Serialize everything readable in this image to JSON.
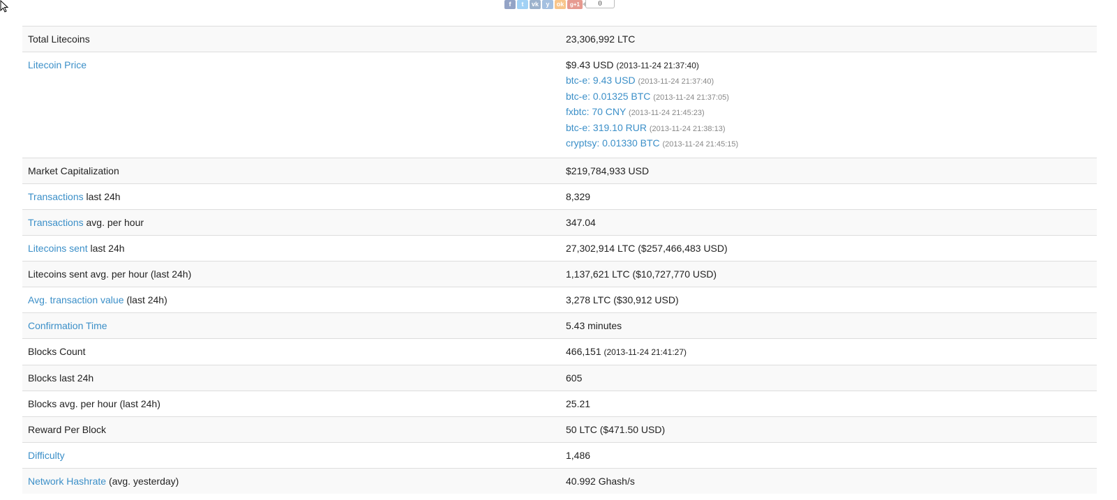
{
  "share": {
    "buttons": [
      {
        "id": "facebook",
        "glyph": "f",
        "color": "#3b5998"
      },
      {
        "id": "twitter",
        "glyph": "t",
        "color": "#55acee"
      },
      {
        "id": "vk",
        "glyph": "vk",
        "color": "#4c75a3"
      },
      {
        "id": "yandex",
        "glyph": "y",
        "color": "#5b8ec7"
      },
      {
        "id": "odnoklassniki",
        "glyph": "ok",
        "color": "#f4962b"
      },
      {
        "id": "gplus",
        "glyph": "g+1",
        "color": "#d34836"
      }
    ],
    "count": "0"
  },
  "colors": {
    "link": "#3b8fc8",
    "text": "#222222",
    "muted": "#888888",
    "row_alt": "#f9f9f9",
    "border": "#dddddd"
  },
  "rows": {
    "total_litecoins": {
      "label": "Total Litecoins",
      "value": "23,306,992 LTC"
    },
    "price": {
      "label": "Litecoin Price",
      "main_value": "$9.43 USD",
      "main_time": "(2013-11-24 21:37:40)",
      "quotes": [
        {
          "text": "btc-e: 9.43 USD",
          "time": "(2013-11-24 21:37:40)"
        },
        {
          "text": "btc-e: 0.01325 BTC",
          "time": "(2013-11-24 21:37:05)"
        },
        {
          "text": "fxbtc: 70 CNY",
          "time": "(2013-11-24 21:45:23)"
        },
        {
          "text": "btc-e: 319.10 RUR",
          "time": "(2013-11-24 21:38:13)"
        },
        {
          "text": "cryptsy: 0.01330 BTC",
          "time": "(2013-11-24 21:45:15)"
        }
      ]
    },
    "market_cap": {
      "label": "Market Capitalization",
      "value": "$219,784,933 USD"
    },
    "tx_24h": {
      "link": "Transactions",
      "suffix": "last 24h",
      "value": "8,329"
    },
    "tx_avg": {
      "link": "Transactions",
      "suffix": "avg. per hour",
      "value": "347.04"
    },
    "sent_24h": {
      "link": "Litecoins sent",
      "suffix": "last 24h",
      "value": "27,302,914 LTC ($257,466,483 USD)"
    },
    "sent_avg": {
      "label": "Litecoins sent avg. per hour (last 24h)",
      "value": "1,137,621 LTC ($10,727,770 USD)"
    },
    "avg_tx_value": {
      "link": "Avg. transaction value",
      "suffix": "(last 24h)",
      "value": "3,278 LTC ($30,912 USD)"
    },
    "confirmation": {
      "link": "Confirmation Time",
      "value": "5.43 minutes"
    },
    "blocks_count": {
      "label": "Blocks Count",
      "value": "466,151",
      "time": "(2013-11-24 21:41:27)"
    },
    "blocks_24h": {
      "label": "Blocks last 24h",
      "value": "605"
    },
    "blocks_avg": {
      "label": "Blocks avg. per hour (last 24h)",
      "value": "25.21"
    },
    "reward": {
      "label": "Reward Per Block",
      "value": "50 LTC ($471.50 USD)"
    },
    "difficulty": {
      "link": "Difficulty",
      "value": "1,486"
    },
    "hashrate": {
      "link": "Network Hashrate",
      "suffix": "(avg. yesterday)",
      "value": "40.992 Ghash/s"
    }
  }
}
